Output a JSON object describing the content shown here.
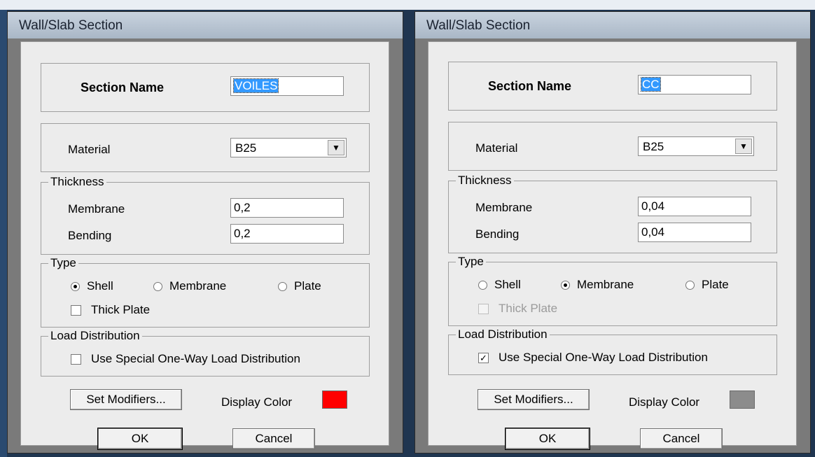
{
  "colors": {
    "red": "#ff0000",
    "gray": "#8c8c8c"
  },
  "dialogs": [
    {
      "title": "Wall/Slab Section",
      "section_name_label": "Section Name",
      "section_name_value": "VOILES",
      "material_label": "Material",
      "material_value": "B25",
      "thickness_legend": "Thickness",
      "membrane_label": "Membrane",
      "membrane_value": "0,2",
      "bending_label": "Bending",
      "bending_value": "0,2",
      "type_legend": "Type",
      "type_options": [
        "Shell",
        "Membrane",
        "Plate"
      ],
      "type_selected": "Shell",
      "thick_plate_label": "Thick Plate",
      "thick_plate_checked": false,
      "thick_plate_enabled": true,
      "load_legend": "Load Distribution",
      "one_way_label": "Use Special One-Way Load Distribution",
      "one_way_checked": false,
      "set_modifiers_label": "Set Modifiers...",
      "display_color_label": "Display Color",
      "display_color": "#ff0000",
      "ok_label": "OK",
      "cancel_label": "Cancel"
    },
    {
      "title": "Wall/Slab Section",
      "section_name_label": "Section Name",
      "section_name_value": "CC",
      "material_label": "Material",
      "material_value": "B25",
      "thickness_legend": "Thickness",
      "membrane_label": "Membrane",
      "membrane_value": "0,04",
      "bending_label": "Bending",
      "bending_value": "0,04",
      "type_legend": "Type",
      "type_options": [
        "Shell",
        "Membrane",
        "Plate"
      ],
      "type_selected": "Membrane",
      "thick_plate_label": "Thick Plate",
      "thick_plate_checked": false,
      "thick_plate_enabled": false,
      "load_legend": "Load Distribution",
      "one_way_label": "Use Special One-Way Load Distribution",
      "one_way_checked": true,
      "set_modifiers_label": "Set Modifiers...",
      "display_color_label": "Display Color",
      "display_color": "#8c8c8c",
      "ok_label": "OK",
      "cancel_label": "Cancel"
    }
  ]
}
